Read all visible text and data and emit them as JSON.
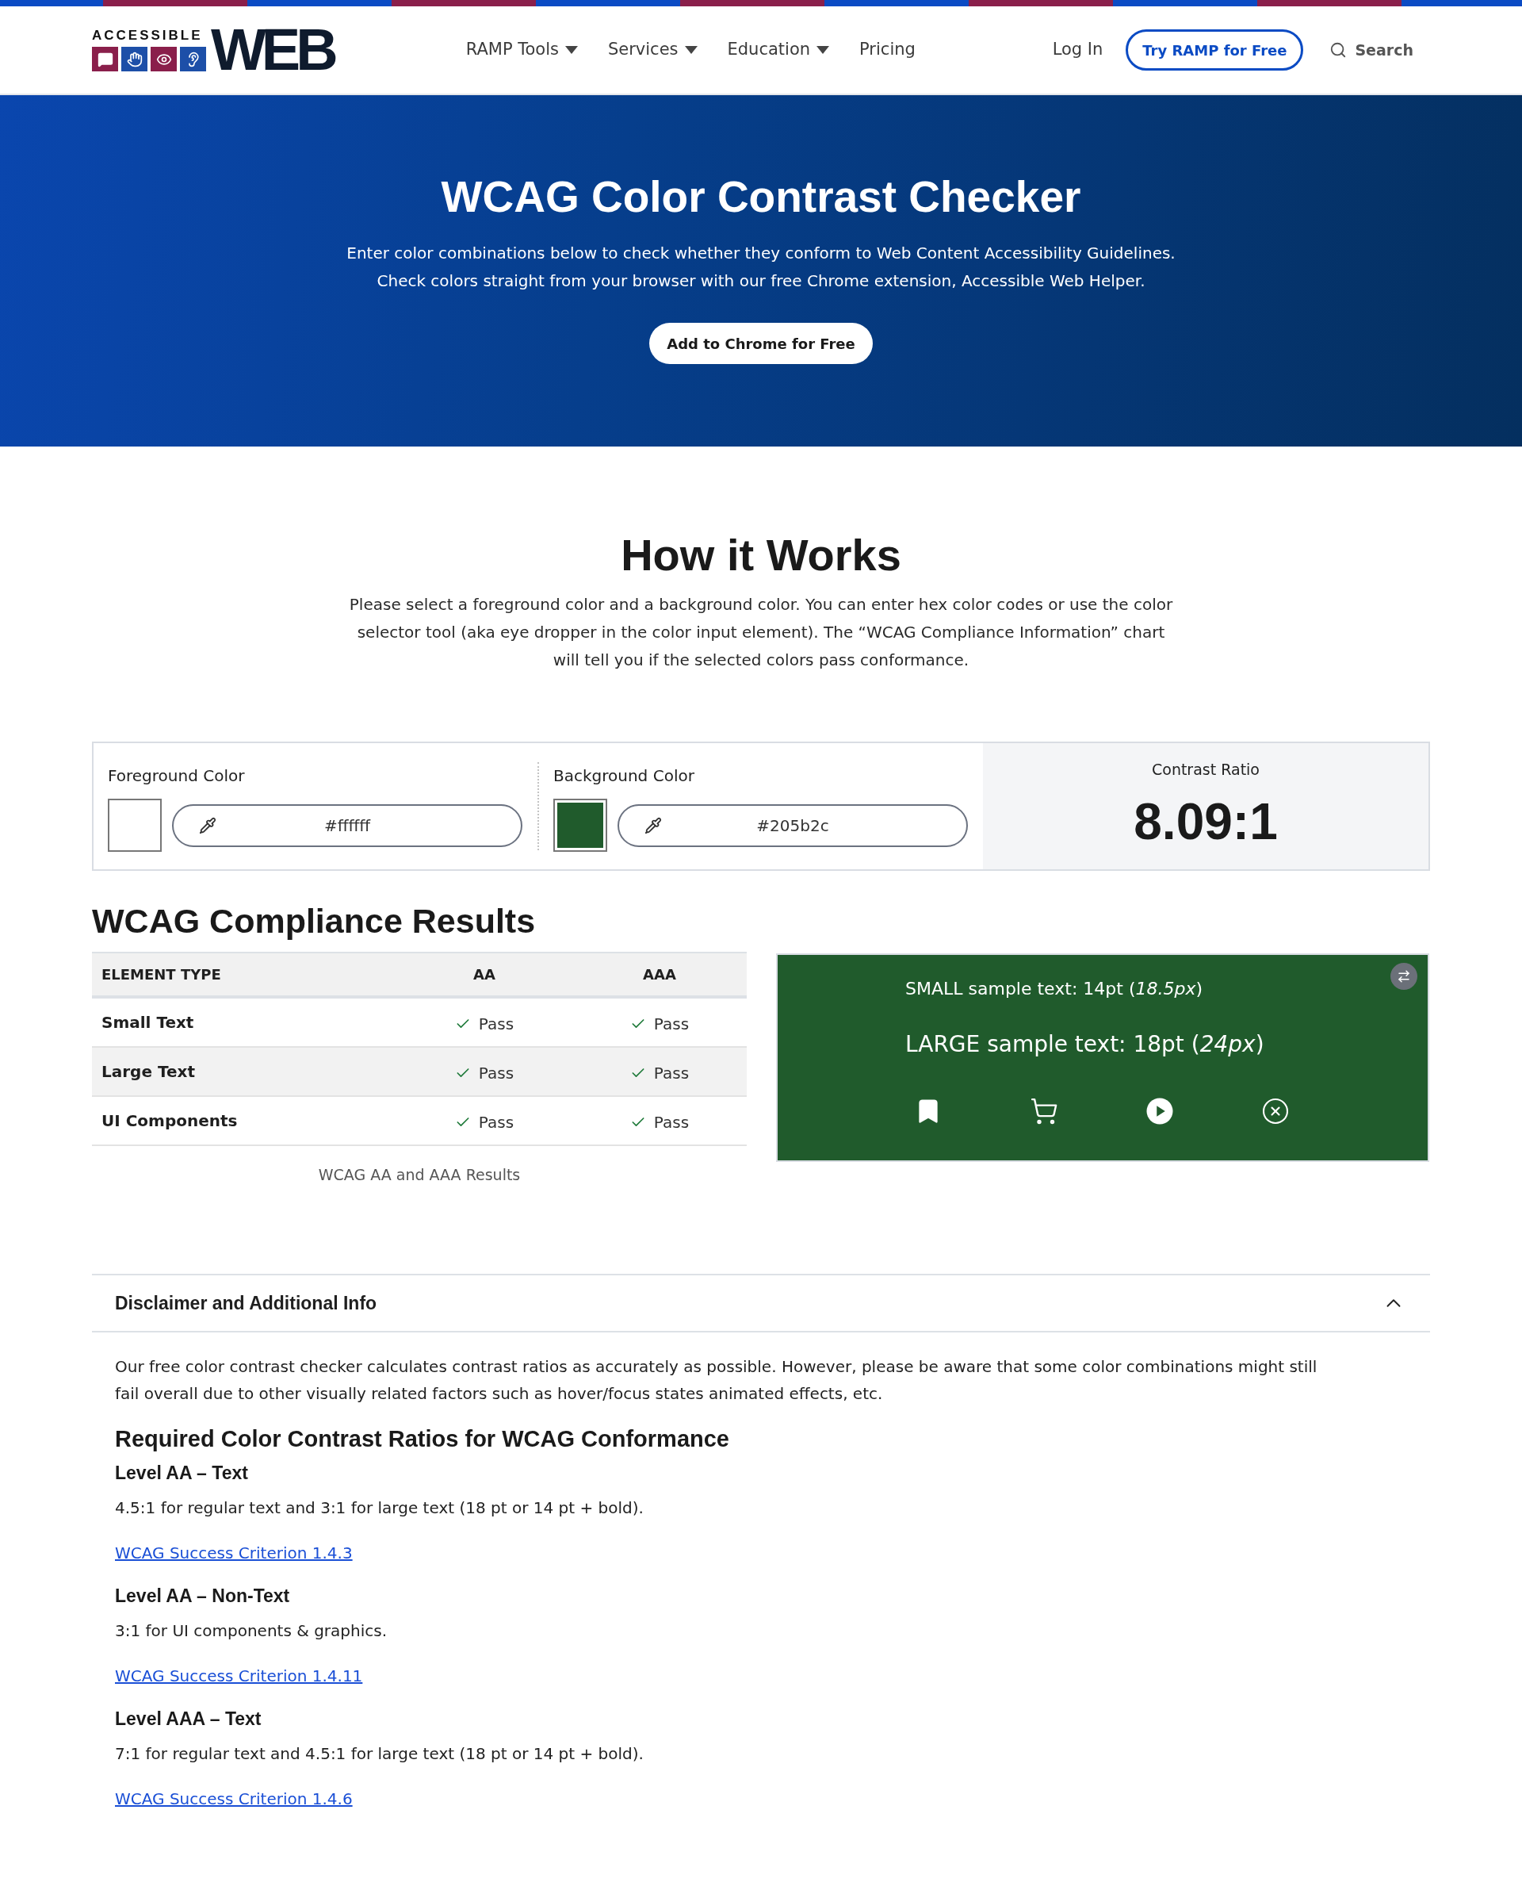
{
  "header": {
    "logo": {
      "small": "ACCESSIBLE",
      "large": "WEB"
    },
    "nav": [
      {
        "label": "RAMP Tools",
        "dropdown": true
      },
      {
        "label": "Services",
        "dropdown": true
      },
      {
        "label": "Education",
        "dropdown": true
      },
      {
        "label": "Pricing",
        "dropdown": false
      }
    ],
    "login": "Log In",
    "cta": "Try RAMP for Free",
    "search": "Search"
  },
  "hero": {
    "title": "WCAG Color Contrast Checker",
    "lines": [
      "Enter color combinations below to check whether they conform to Web Content Accessibility Guidelines.",
      "Check colors straight from your browser with our free Chrome extension, Accessible Web Helper."
    ],
    "button": "Add to Chrome for Free"
  },
  "how_it_works": {
    "title": "How it Works",
    "lines": [
      "Please select a foreground color and a background color. You can enter hex color codes or use the color",
      "selector tool (aka eye dropper in the color input element). The “WCAG Compliance Information” chart",
      "will tell you if the selected colors pass conformance."
    ]
  },
  "colors": [
    {
      "label": "Foreground Color",
      "value": "#ffffff",
      "color": "#ffffff"
    },
    {
      "label": "Background Color",
      "value": "#205b2c",
      "color": "#205b2c"
    }
  ],
  "contrast": {
    "label": "Contrast Ratio",
    "value": "8.09:1"
  },
  "results": {
    "title": "WCAG Compliance Results",
    "columns": [
      "ELEMENT TYPE",
      "AA",
      "AAA"
    ],
    "rows": [
      {
        "cells": [
          {
            "kind": "label",
            "text": "Small Text"
          },
          {
            "kind": "result",
            "text": "Pass",
            "passed": true
          },
          {
            "kind": "result",
            "text": "Pass",
            "passed": true
          }
        ]
      },
      {
        "cells": [
          {
            "kind": "label",
            "text": "Large Text"
          },
          {
            "kind": "result",
            "text": "Pass",
            "passed": true
          },
          {
            "kind": "result",
            "text": "Pass",
            "passed": true
          }
        ]
      },
      {
        "cells": [
          {
            "kind": "label",
            "text": "UI Components"
          },
          {
            "kind": "result",
            "text": "Pass",
            "passed": true
          },
          {
            "kind": "result",
            "text": "Pass",
            "passed": true
          }
        ]
      }
    ],
    "caption": "WCAG AA and AAA Results"
  },
  "sample": {
    "small": "SMALL sample text: 14pt (*18.5px*)",
    "large": "LARGE sample text: 18pt (*24px*)"
  },
  "disclaimer": {
    "title": "Disclaimer and Additional Info",
    "expanded": true,
    "lines": [
      "Our free color contrast checker calculates contrast ratios as accurately as possible. However, please be aware that some color combinations might still",
      "fail overall due to other visually related factors such as hover/focus states animated effects, etc."
    ],
    "heading": "Required Color Contrast Ratios for WCAG Conformance",
    "levels": [
      {
        "title": "Level AA – Text",
        "text": "4.5:1 for regular text and 3:1 for large text (18 pt or 14 pt + bold).",
        "link": "WCAG Success Criterion 1.4.3"
      },
      {
        "title": "Level AA – Non-Text",
        "text": "3:1 for UI components & graphics.",
        "link": "WCAG Success Criterion 1.4.11"
      },
      {
        "title": "Level AAA – Text",
        "text": "7:1 for regular text and 4.5:1 for large text (18 pt or 14 pt + bold).",
        "link": "WCAG Success Criterion 1.4.6"
      }
    ]
  }
}
